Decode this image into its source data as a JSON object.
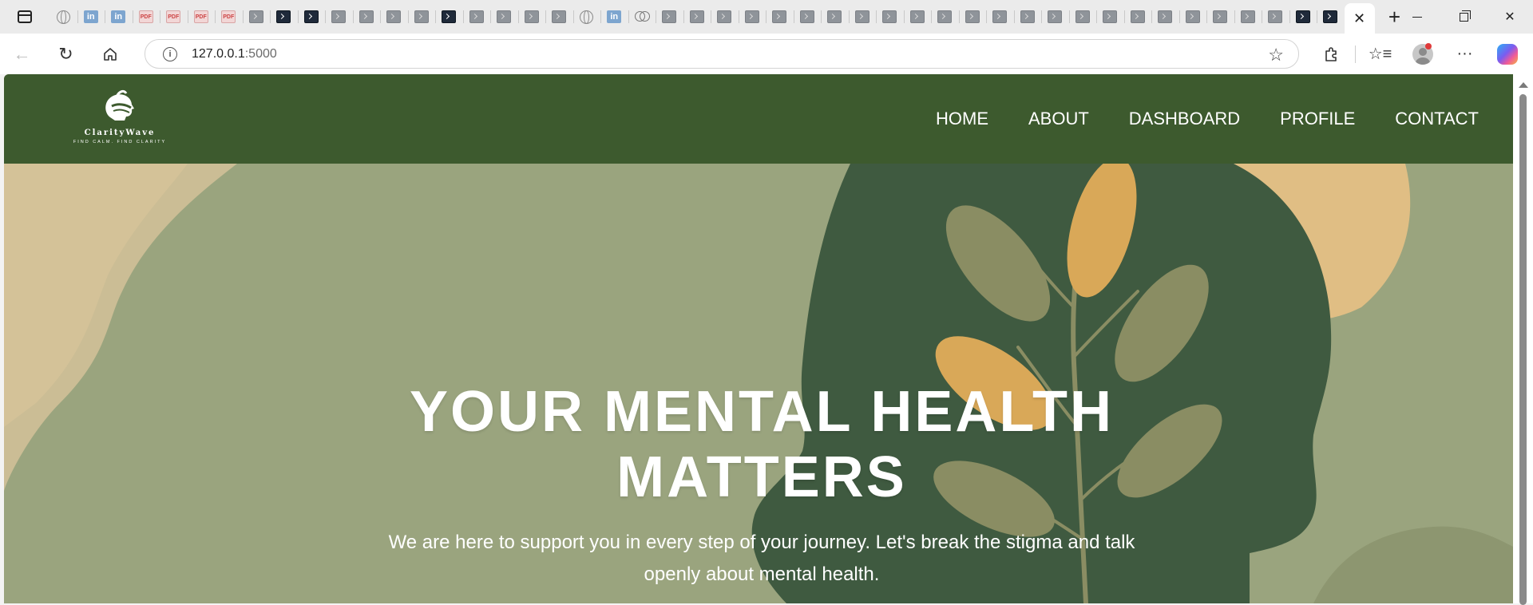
{
  "browser": {
    "tabs": [
      {
        "icon": "globe-icon"
      },
      {
        "icon": "linkedin-icon",
        "glyph": "in"
      },
      {
        "icon": "linkedin-icon",
        "glyph": "in"
      },
      {
        "icon": "pdf-icon",
        "glyph": "PDF"
      },
      {
        "icon": "pdf-icon",
        "glyph": "PDF"
      },
      {
        "icon": "pdf-icon",
        "glyph": "PDF"
      },
      {
        "icon": "pdf-icon",
        "glyph": "PDF"
      },
      {
        "icon": "page-icon"
      },
      {
        "icon": "terminal-icon"
      },
      {
        "icon": "terminal-icon"
      },
      {
        "icon": "page-icon"
      },
      {
        "icon": "page-icon"
      },
      {
        "icon": "page-icon"
      },
      {
        "icon": "page-icon"
      },
      {
        "icon": "terminal-icon"
      },
      {
        "icon": "page-icon"
      },
      {
        "icon": "page-icon"
      },
      {
        "icon": "page-icon"
      },
      {
        "icon": "page-icon"
      },
      {
        "icon": "globe-icon"
      },
      {
        "icon": "linkedin-icon",
        "glyph": "in"
      },
      {
        "icon": "rings-icon"
      },
      {
        "icon": "page-icon"
      },
      {
        "icon": "page-icon"
      },
      {
        "icon": "page-icon"
      },
      {
        "icon": "page-icon"
      },
      {
        "icon": "page-icon"
      },
      {
        "icon": "page-icon"
      },
      {
        "icon": "page-icon"
      },
      {
        "icon": "page-icon"
      },
      {
        "icon": "page-icon"
      },
      {
        "icon": "page-icon"
      },
      {
        "icon": "page-icon"
      },
      {
        "icon": "page-icon"
      },
      {
        "icon": "page-icon"
      },
      {
        "icon": "page-icon"
      },
      {
        "icon": "page-icon"
      },
      {
        "icon": "page-icon"
      },
      {
        "icon": "page-icon"
      },
      {
        "icon": "page-icon"
      },
      {
        "icon": "page-icon"
      },
      {
        "icon": "page-icon"
      },
      {
        "icon": "page-icon"
      },
      {
        "icon": "page-icon"
      },
      {
        "icon": "page-icon"
      },
      {
        "icon": "terminal-icon"
      },
      {
        "icon": "terminal-icon"
      }
    ],
    "active_tab_close": "✕",
    "new_tab": "+",
    "address": {
      "host": "127.0.0.1",
      "port": ":5000"
    }
  },
  "site": {
    "logo": {
      "name": "ClarityWave",
      "tagline": "FIND CALM. FIND CLARITY"
    },
    "nav": [
      "HOME",
      "ABOUT",
      "DASHBOARD",
      "PROFILE",
      "CONTACT"
    ],
    "hero": {
      "title_line1": "YOUR MENTAL HEALTH",
      "title_line2": "MATTERS",
      "subtitle_line1": "We are here to support you in every step of your journey. Let's break the stigma and talk",
      "subtitle_line2": "openly about mental health."
    }
  },
  "colors": {
    "header": "#3d5a2e",
    "hero_bg": "#9aa47e",
    "head_silhouette": "#3f5a40",
    "sand": "#dcc79a",
    "leaf_gold": "#d9a858",
    "leaf_olive": "#8a8d63"
  }
}
